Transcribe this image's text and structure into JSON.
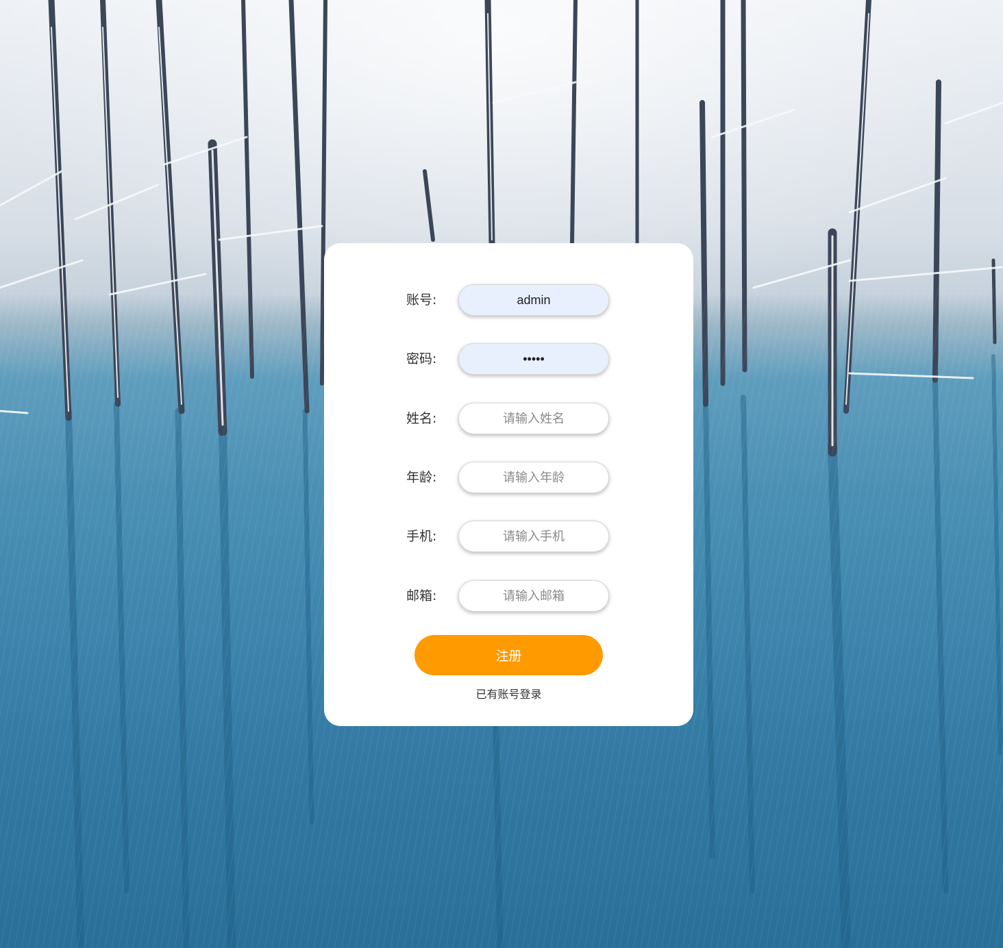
{
  "form": {
    "fields": [
      {
        "label": "账号:",
        "value": "admin",
        "placeholder": "",
        "type": "text"
      },
      {
        "label": "密码:",
        "value": "admin",
        "placeholder": "",
        "type": "password"
      },
      {
        "label": "姓名:",
        "value": "",
        "placeholder": "请输入姓名",
        "type": "text"
      },
      {
        "label": "年龄:",
        "value": "",
        "placeholder": "请输入年龄",
        "type": "text"
      },
      {
        "label": "手机:",
        "value": "",
        "placeholder": "请输入手机",
        "type": "text"
      },
      {
        "label": "邮箱:",
        "value": "",
        "placeholder": "请输入邮箱",
        "type": "text"
      }
    ],
    "submit_label": "注册",
    "login_link": "已有账号登录"
  },
  "colors": {
    "button": "#ff9a00",
    "autofill": "#e8f0fe",
    "card": "#ffffff"
  }
}
